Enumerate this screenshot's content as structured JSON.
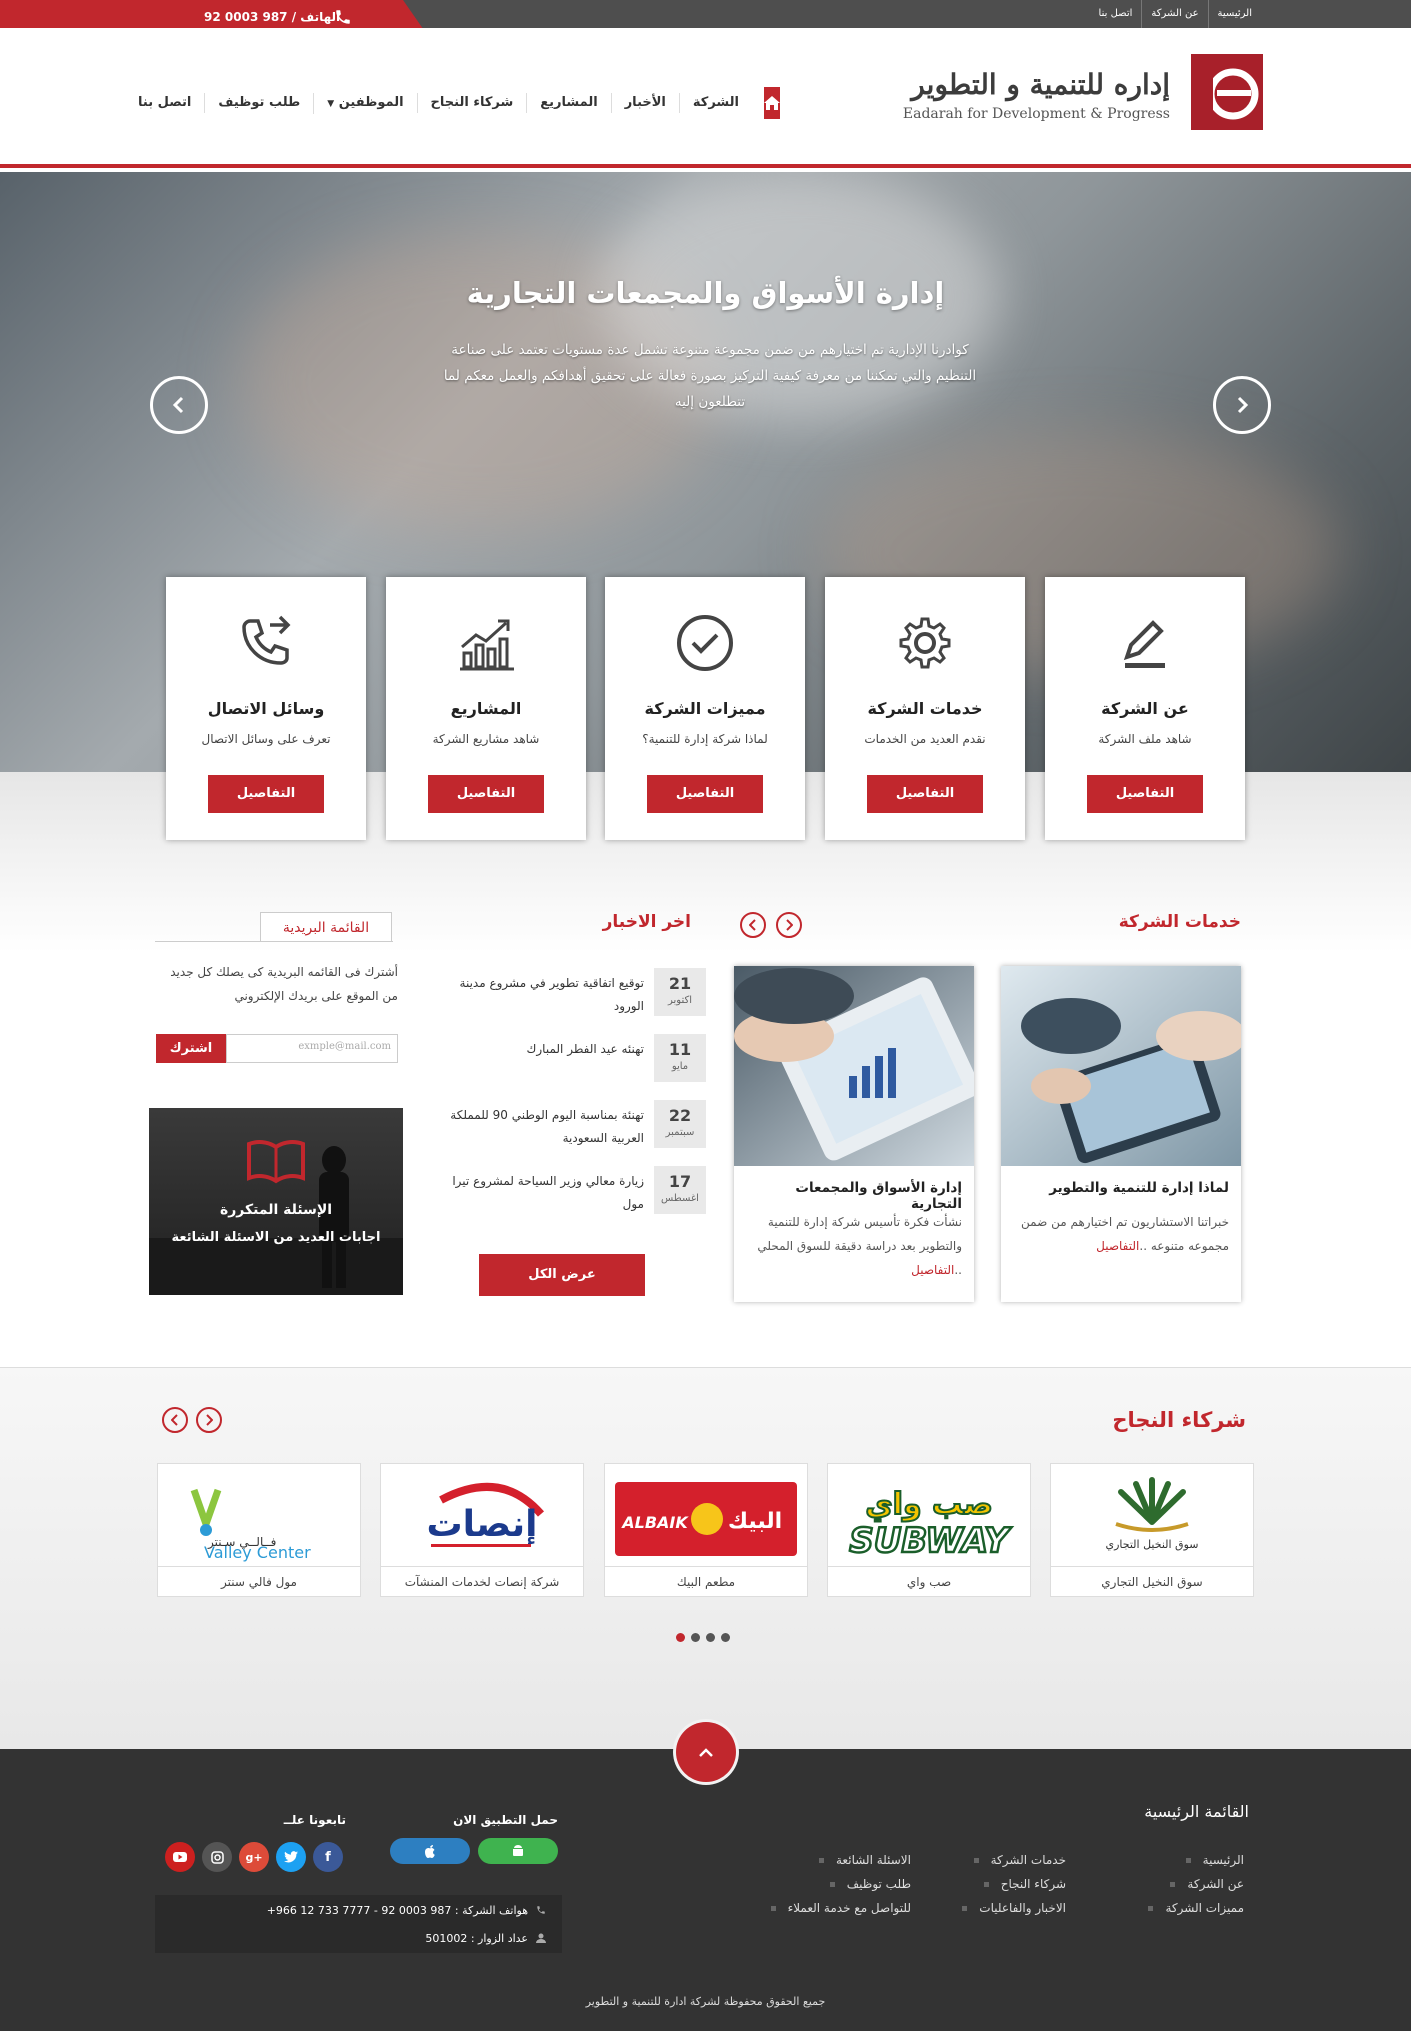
{
  "topbar": {
    "links": [
      "الرئيسية",
      "عن الشركة",
      "اتصل بنا"
    ],
    "phone_label": "الهاتف / 987 0003 92"
  },
  "logo": {
    "arabic": "إداره للتنمية و التطوير",
    "english": "Eadarah for Development & Progress"
  },
  "nav": {
    "items": [
      "الشركة",
      "الأخبار",
      "المشاريع",
      "شركاء النجاح",
      "الموظفين",
      "طلب توظيف",
      "اتصل بنا"
    ]
  },
  "hero": {
    "title": "إدارة الأسواق والمجمعات التجارية",
    "text": "كوادرنا الإدارية تم اختيارهم من ضمن مجموعة متنوعة تشمل عدة مستويات تعتمد على صناعة التنظيم والتي تمكننا من معرفة كيفية التركيز بصورة فعالة على تحقيق أهدافكم والعمل معكم لما تتطلعون إليه"
  },
  "cards": [
    {
      "title": "عن الشركة",
      "sub": "شاهد ملف الشركة",
      "btn": "التفاصيل",
      "icon": "pencil-icon"
    },
    {
      "title": "خدمات الشركة",
      "sub": "نقدم العديد من الخدمات",
      "btn": "التفاصيل",
      "icon": "gear-icon"
    },
    {
      "title": "مميزات الشركة",
      "sub": "لماذا شركة إدارة للتنمية؟",
      "btn": "التفاصيل",
      "icon": "check-circle-icon"
    },
    {
      "title": "المشاريع",
      "sub": "شاهد مشاريع الشركة",
      "btn": "التفاصيل",
      "icon": "growth-chart-icon"
    },
    {
      "title": "وسائل الاتصال",
      "sub": "تعرف على وسائل الاتصال",
      "btn": "التفاصيل",
      "icon": "phone-call-icon"
    }
  ],
  "services": {
    "title": "خدمات الشركة",
    "items": [
      {
        "title": "لماذا إدارة للتنمية والتطوير",
        "desc": "خبراتنا الاستشاريون تم اختيارهم من ضمن مجموعه متنوعه ..",
        "more": "التفاصيل"
      },
      {
        "title": "إدارة الأسواق والمجمعات التجارية",
        "desc": "نشأت فكرة تأسيس شركة إدارة للتنمية والتطوير بعد دراسة دقيقة للسوق المحلي ..",
        "more": "التفاصيل"
      }
    ]
  },
  "news": {
    "title": "اخر الاخبار",
    "items": [
      {
        "day": "21",
        "month": "اكتوبر",
        "text": "توقيع اتفاقية تطوير في مشروع مدينة الورود"
      },
      {
        "day": "11",
        "month": "مايو",
        "text": "تهنئه عيد الفطر المبارك"
      },
      {
        "day": "22",
        "month": "سبتمبر",
        "text": "تهنئة بمناسبة اليوم الوطني 90 للمملكة العربية السعودية"
      },
      {
        "day": "17",
        "month": "اغسطس",
        "text": "زيارة معالي وزير السياحة لمشروع تيرا مول"
      }
    ],
    "view_all": "عرض الكل"
  },
  "newsletter": {
    "tab": "القائمة البريدية",
    "desc": "أشترك فى القائمه البريدية كى يصلك كل جديد من الموقع على بريدك الإلكتروني",
    "placeholder": "exmple@mail.com",
    "button": "اشترك"
  },
  "faq": {
    "title": "الإسئلة المتكررة",
    "sub": "اجابات العديد من الاسئلة الشائعة"
  },
  "partners": {
    "title": "شركاء النجاح",
    "items": [
      {
        "name": "سوق النخيل التجاري",
        "logo_text": "سوق النخيل التجاري"
      },
      {
        "name": "صب واي",
        "logo_text": "SUBWAY"
      },
      {
        "name": "مطعم البيك",
        "logo_text": "ALBAIK"
      },
      {
        "name": "شركة إنصات لخدمات المنشآت",
        "logo_text": "إنصات"
      },
      {
        "name": "مول فالي سنتر",
        "logo_text": "Valley Center"
      }
    ]
  },
  "footer": {
    "menu_title": "القائمة الرئيسية",
    "col1": [
      "الرئيسية",
      "عن الشركة",
      "مميزات الشركة"
    ],
    "col2": [
      "خدمات الشركة",
      "شركاء النجاح",
      "الاخبار والفاعليات"
    ],
    "col3": [
      "الاسئلة الشائعة",
      "طلب توظيف",
      "للتواصل مع خدمة العملاء"
    ],
    "app_title": "حمل التطبيق الان",
    "follow_title": "تابعونا علــ",
    "phones": "هواتف الشركة : 987 0003 92 - 7777 733 12 966+",
    "visitors": "عداد الزوار : 501002",
    "copyright": "جميع الحقوق محفوظة لشركة ادارة للتنمية و التطوير"
  },
  "colors": {
    "accent": "#c1272d",
    "dark": "#333333",
    "topbar": "#4e4e4e"
  }
}
